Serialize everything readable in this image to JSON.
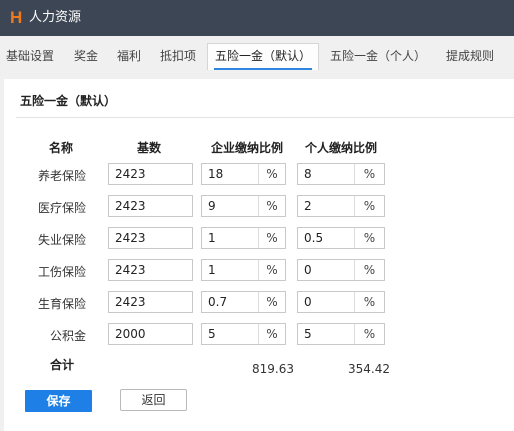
{
  "app": {
    "logo": "H",
    "title": "人力资源"
  },
  "tabs": [
    {
      "label": "基础设置"
    },
    {
      "label": "奖金"
    },
    {
      "label": "福利"
    },
    {
      "label": "抵扣项"
    },
    {
      "label": "五险一金（默认）",
      "active": true
    },
    {
      "label": "五险一金（个人）"
    },
    {
      "label": "提成规则"
    }
  ],
  "panel": {
    "title": "五险一金（默认）"
  },
  "table": {
    "headers": {
      "name": "名称",
      "base": "基数",
      "company_rate": "企业缴纳比例",
      "personal_rate": "个人缴纳比例"
    },
    "unit": "%",
    "rows": [
      {
        "name": "养老保险",
        "base": "2423",
        "company": "18",
        "personal": "8"
      },
      {
        "name": "医疗保险",
        "base": "2423",
        "company": "9",
        "personal": "2"
      },
      {
        "name": "失业保险",
        "base": "2423",
        "company": "1",
        "personal": "0.5"
      },
      {
        "name": "工伤保险",
        "base": "2423",
        "company": "1",
        "personal": "0"
      },
      {
        "name": "生育保险",
        "base": "2423",
        "company": "0.7",
        "personal": "0"
      },
      {
        "name": "公积金",
        "base": "2000",
        "company": "5",
        "personal": "5"
      }
    ],
    "total": {
      "label": "合计",
      "company": "819.63",
      "personal": "354.42"
    }
  },
  "buttons": {
    "save": "保存",
    "back": "返回"
  },
  "colors": {
    "titlebar": "#3d4654",
    "logo": "#f07a1b",
    "primary": "#1e7fe6",
    "tab_underline": "#2f86e0"
  }
}
